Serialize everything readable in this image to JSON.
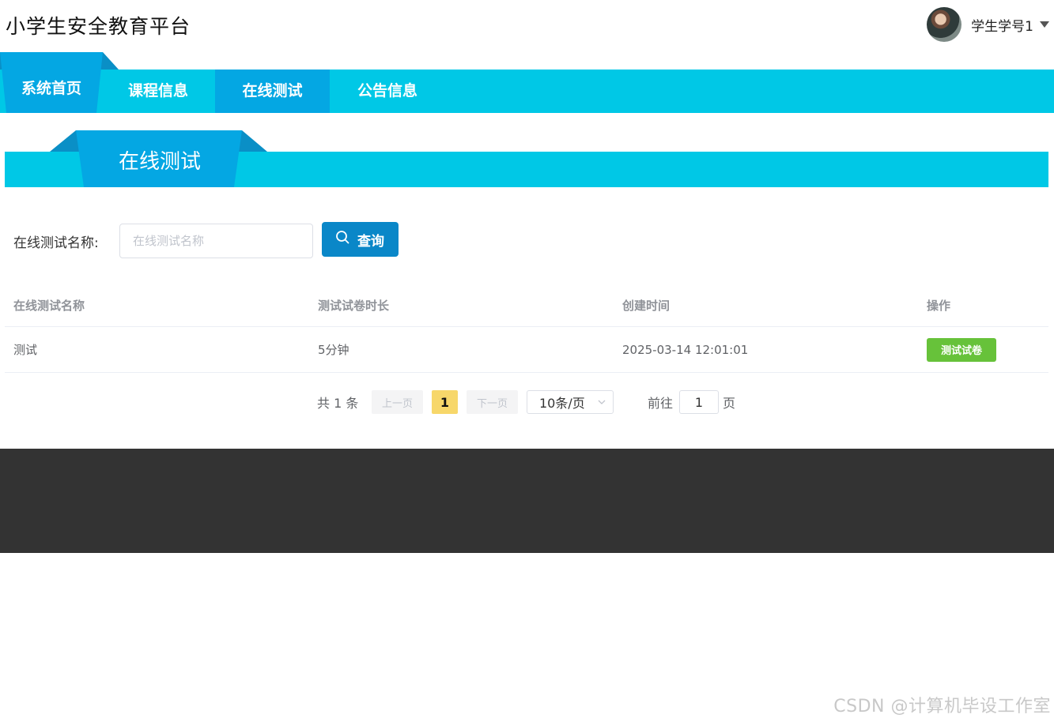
{
  "header": {
    "site_title": "小学生安全教育平台",
    "user_name": "学生学号1"
  },
  "nav": {
    "items": [
      {
        "label": "系统首页"
      },
      {
        "label": "课程信息"
      },
      {
        "label": "在线测试"
      },
      {
        "label": "公告信息"
      }
    ],
    "active_index": 2
  },
  "banner": {
    "title": "在线测试"
  },
  "search": {
    "label": "在线测试名称:",
    "placeholder": "在线测试名称",
    "value": "",
    "button_label": "查询"
  },
  "table": {
    "columns": [
      "在线测试名称",
      "测试试卷时长",
      "创建时间",
      "操作"
    ],
    "rows": [
      {
        "name": "测试",
        "duration": "5分钟",
        "created": "2025-03-14 12:01:01",
        "action": "测试试卷"
      }
    ]
  },
  "pagination": {
    "total": "共 1 条",
    "prev": "上一页",
    "current_page": "1",
    "next": "下一页",
    "page_size": "10条/页",
    "goto_label": "前往",
    "goto_value": "1",
    "goto_unit": "页"
  },
  "watermark": "CSDN @计算机毕设工作室",
  "colors": {
    "nav": "#00c8e6",
    "nav_active": "#04a7e3",
    "search_button": "#0a87c8",
    "action_button": "#67c23a",
    "current_page": "#f7d76a",
    "footer": "#333333"
  },
  "icons": {
    "search": "search-icon",
    "user_menu": "caret-down-icon",
    "page_size": "chevron-down-icon"
  }
}
